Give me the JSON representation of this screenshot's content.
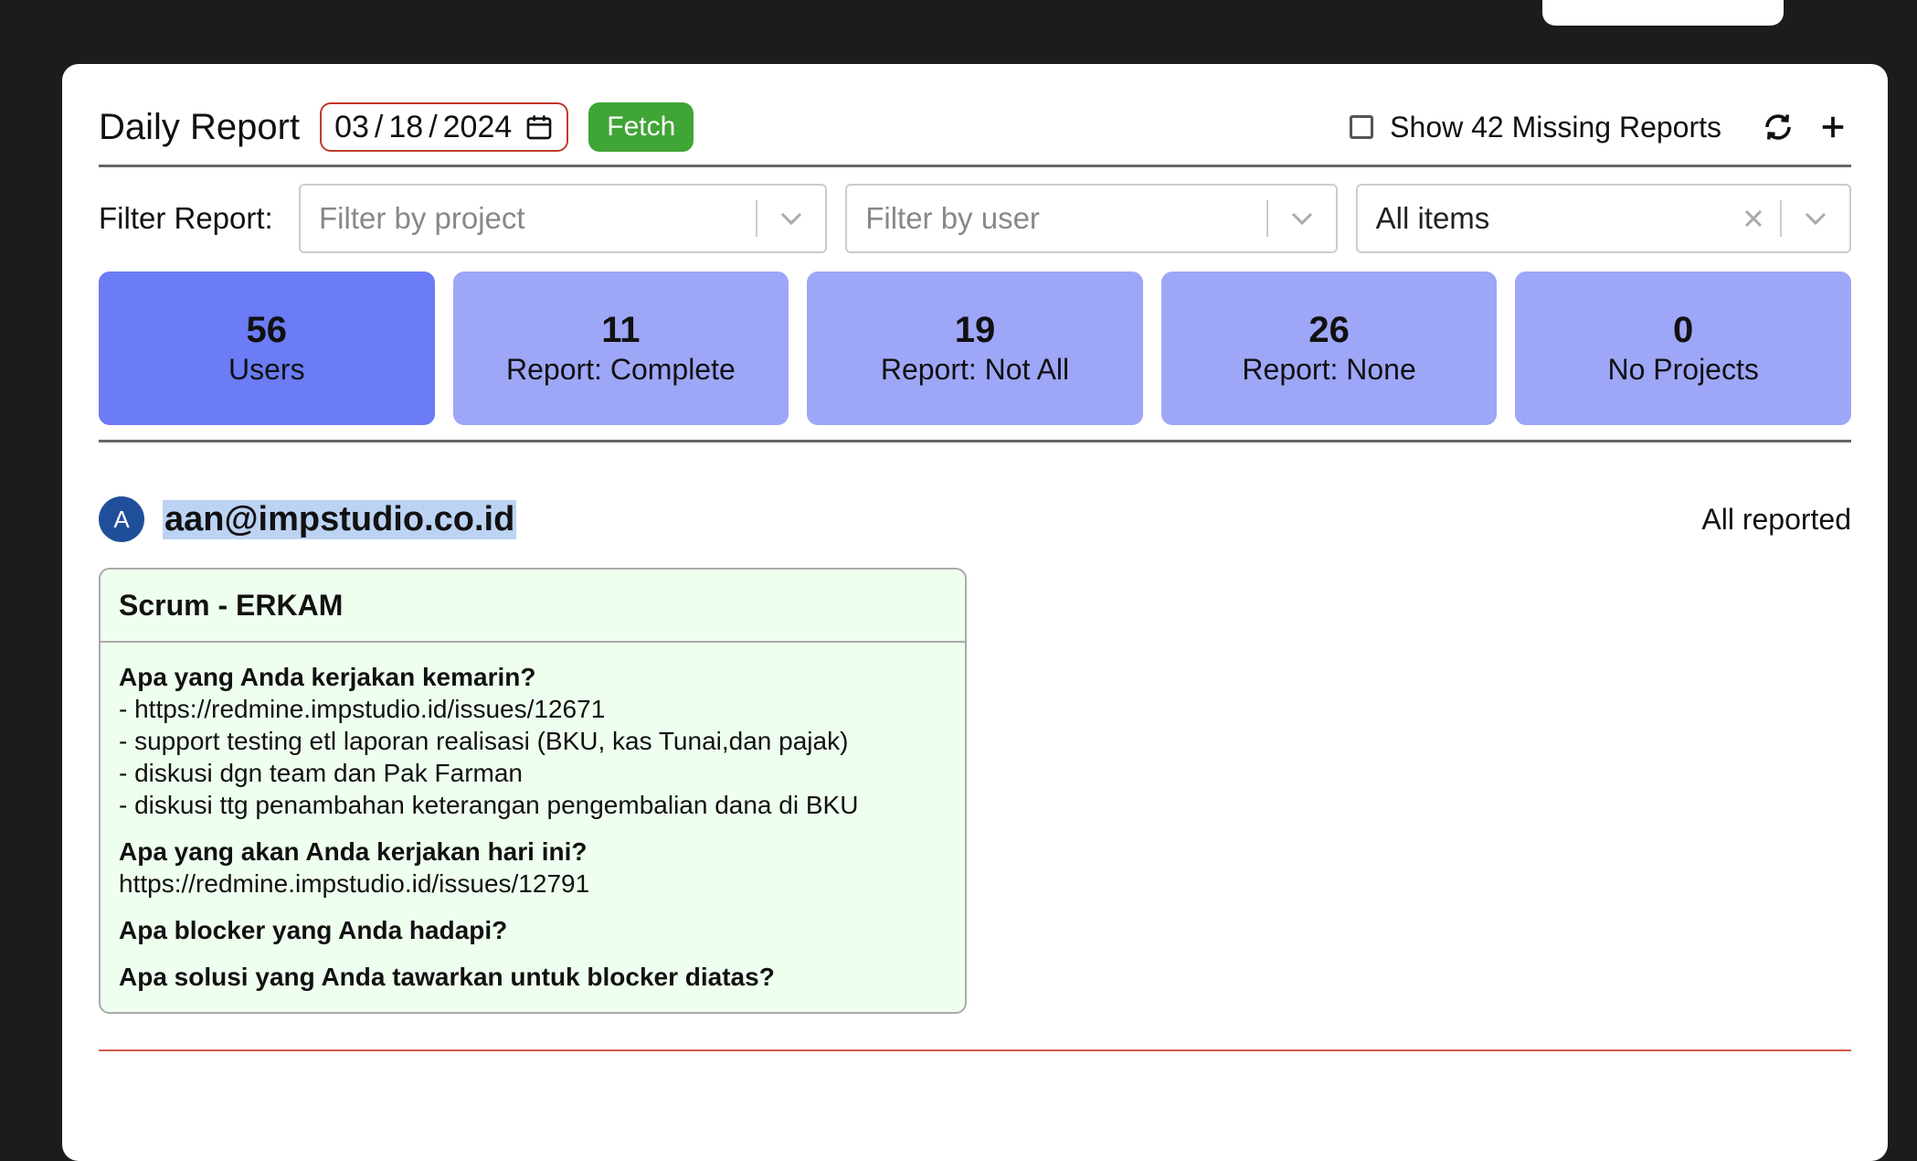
{
  "header": {
    "title": "Daily Report",
    "date": {
      "month": "03",
      "day": "18",
      "year": "2024"
    },
    "fetch_label": "Fetch",
    "missing_label": "Show 42 Missing Reports"
  },
  "filters": {
    "label": "Filter Report:",
    "project_placeholder": "Filter by project",
    "user_placeholder": "Filter by user",
    "items_value": "All items"
  },
  "stats": [
    {
      "value": "56",
      "label": "Users"
    },
    {
      "value": "11",
      "label": "Report: Complete"
    },
    {
      "value": "19",
      "label": "Report: Not All"
    },
    {
      "value": "26",
      "label": "Report: None"
    },
    {
      "value": "0",
      "label": "No Projects"
    }
  ],
  "user": {
    "initial": "A",
    "email": "aan@impstudio.co.id",
    "status": "All reported"
  },
  "report": {
    "title": "Scrum - ERKAM",
    "q1": "Apa yang Anda kerjakan kemarin?",
    "a1": [
      "- https://redmine.impstudio.id/issues/12671",
      "- support testing etl laporan realisasi (BKU, kas Tunai,dan pajak)",
      "- diskusi dgn team dan Pak Farman",
      "- diskusi ttg penambahan keterangan pengembalian dana di BKU"
    ],
    "q2": "Apa yang akan Anda kerjakan hari ini?",
    "a2": "https://redmine.impstudio.id/issues/12791",
    "q3": "Apa blocker yang Anda hadapi?",
    "q4": "Apa solusi yang Anda tawarkan untuk blocker diatas?"
  },
  "colors": {
    "fetch": "#3fa535",
    "stat_active": "#6b7cf5",
    "stat": "#9ea6f7",
    "card_bg": "#efffef",
    "avatar": "#1f4f9a",
    "date_border": "#c0392b"
  }
}
